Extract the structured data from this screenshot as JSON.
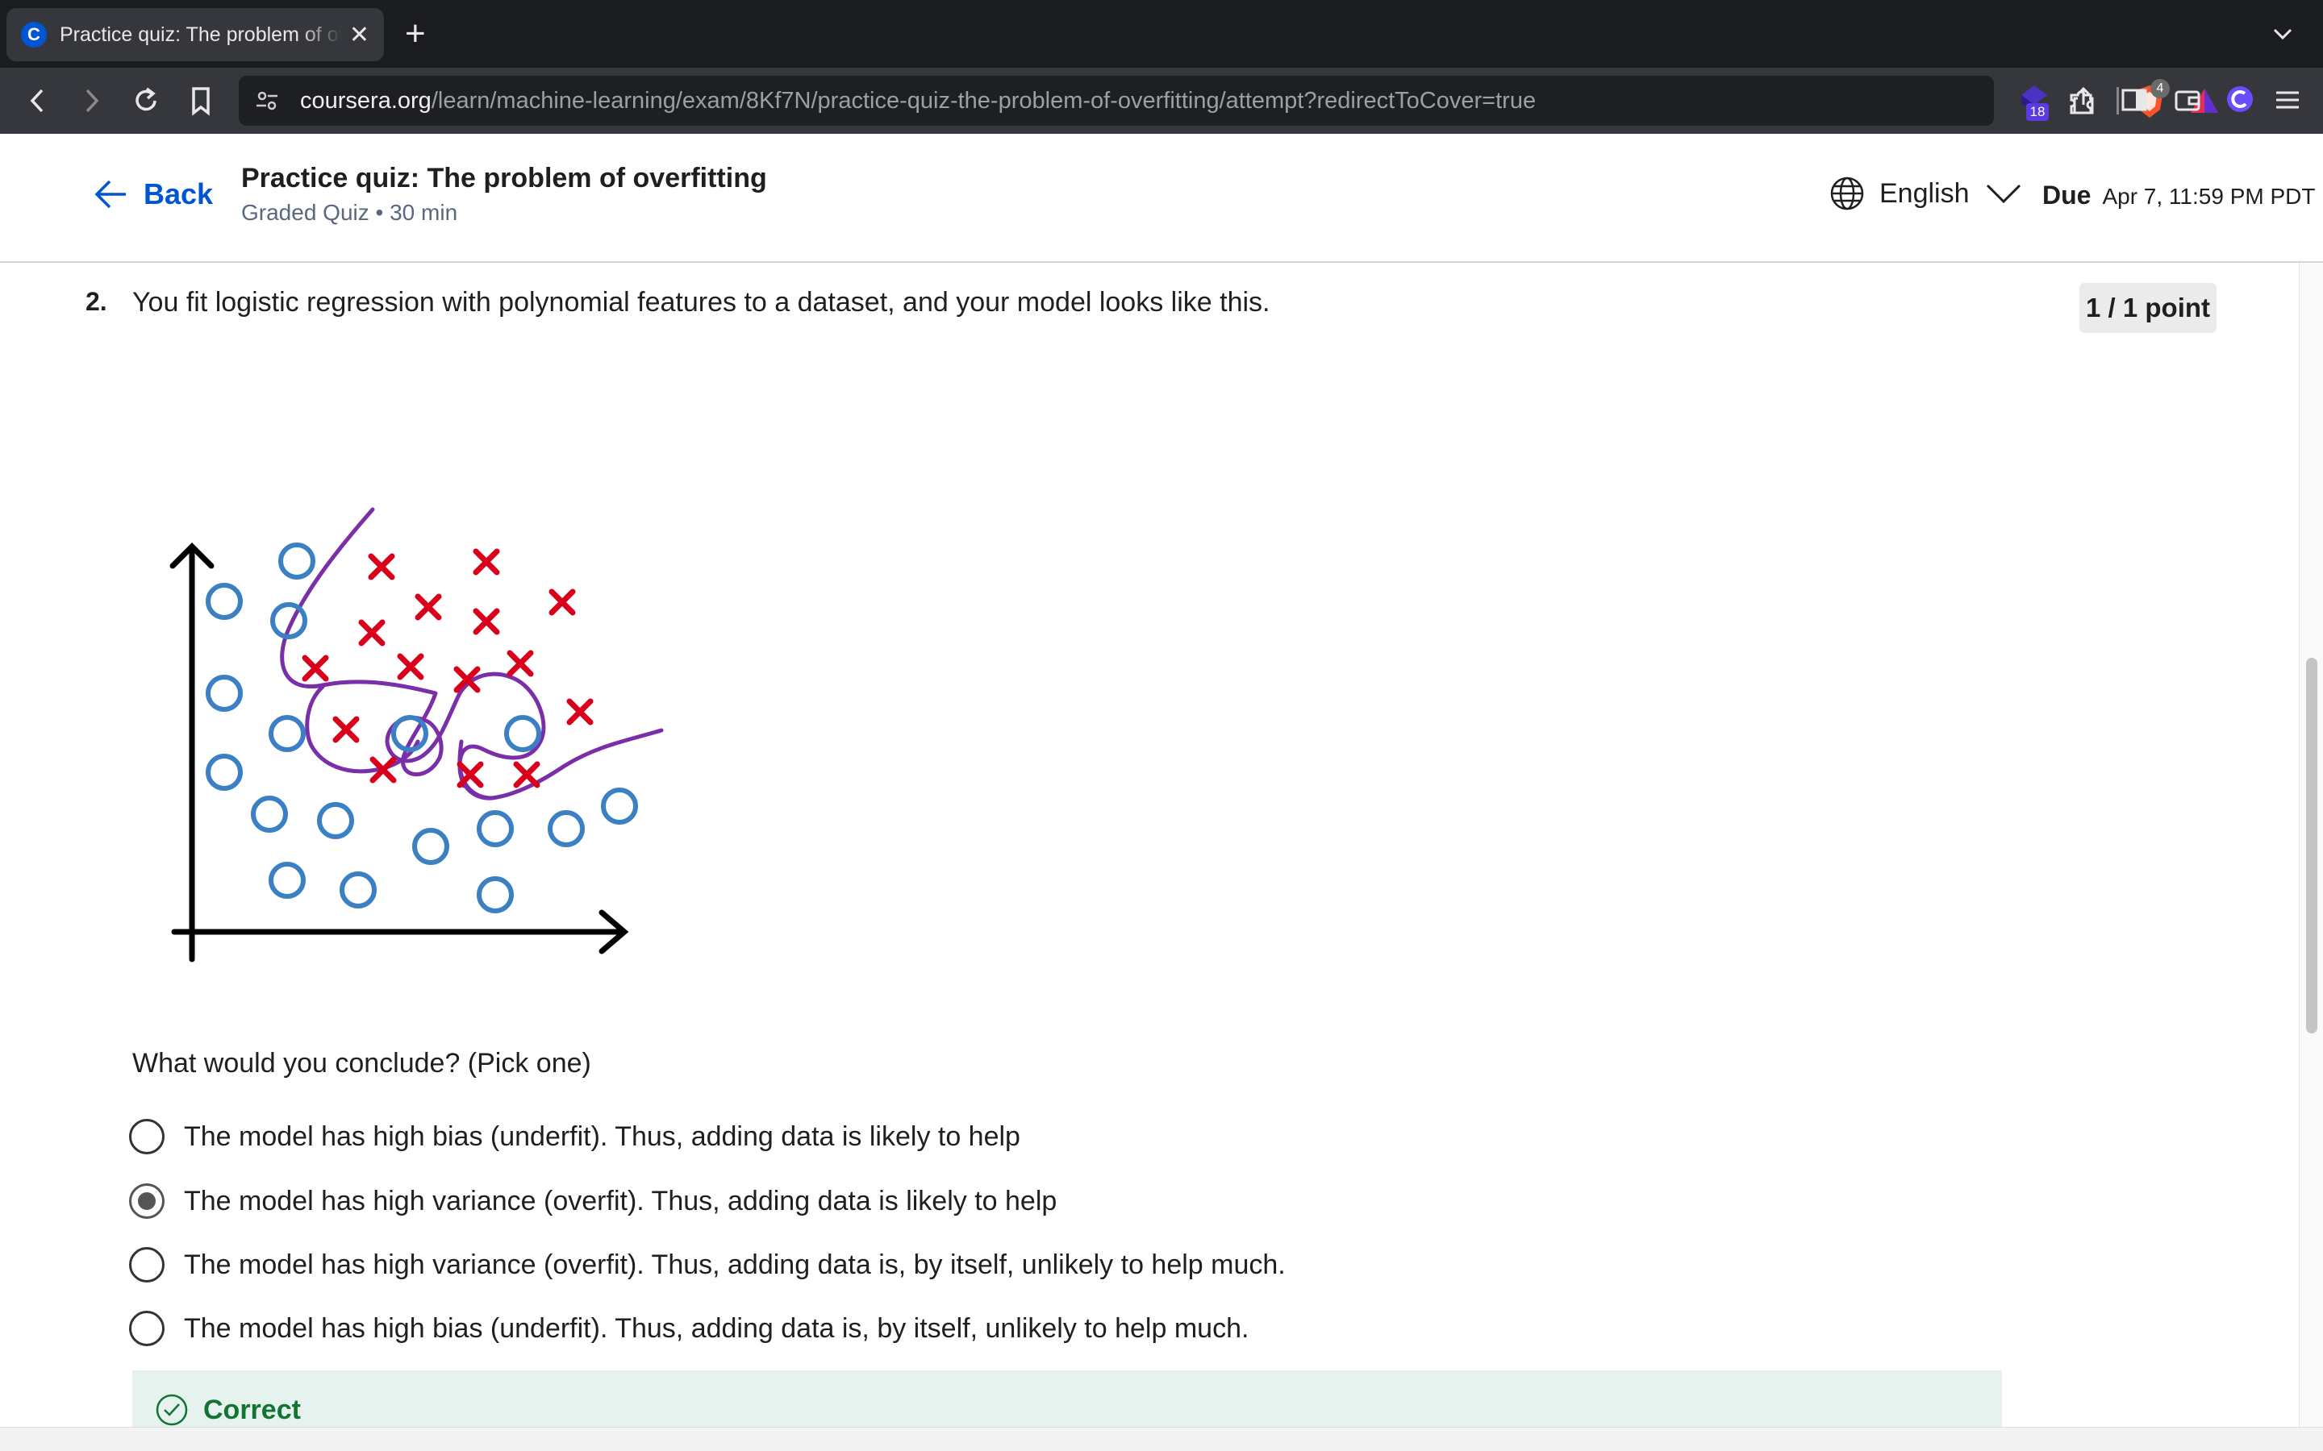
{
  "browser": {
    "tab_title": "Practice quiz: The problem of overfitting",
    "tab_favicon": "C",
    "url_host": "coursera.org",
    "url_path": "/learn/machine-learning/exam/8Kf7N/practice-quiz-the-problem-of-overfitting/attempt?redirectToCover=true",
    "shield_count": "4",
    "extension_badge": "18"
  },
  "header": {
    "back_label": "Back",
    "title": "Practice quiz: The problem of overfitting",
    "subtitle": "Graded Quiz • 30 min",
    "language": "English",
    "due_label": "Due",
    "due_date": "Apr 7, 11:59 PM PDT"
  },
  "question": {
    "number": "2.",
    "text": "You fit logistic regression with polynomial features to a dataset, and your model looks like this.",
    "points": "1 / 1 point",
    "prompt": "What would you conclude? (Pick one)",
    "options": [
      {
        "label": "The model has high bias (underfit). Thus, adding data is likely to help",
        "selected": false
      },
      {
        "label": "The model has high variance (overfit). Thus, adding data is likely to help",
        "selected": true
      },
      {
        "label": "The model has high variance (overfit). Thus, adding data is, by itself, unlikely to help much.",
        "selected": false
      },
      {
        "label": "The model has high bias (underfit). Thus, adding data is, by itself, unlikely to help much.",
        "selected": false
      }
    ],
    "feedback": "Correct"
  },
  "colors": {
    "accent": "#0056d2",
    "cross": "#d9001b",
    "circle": "#3b7fc4",
    "boundary": "#7a2fa8",
    "correct": "#137333"
  }
}
